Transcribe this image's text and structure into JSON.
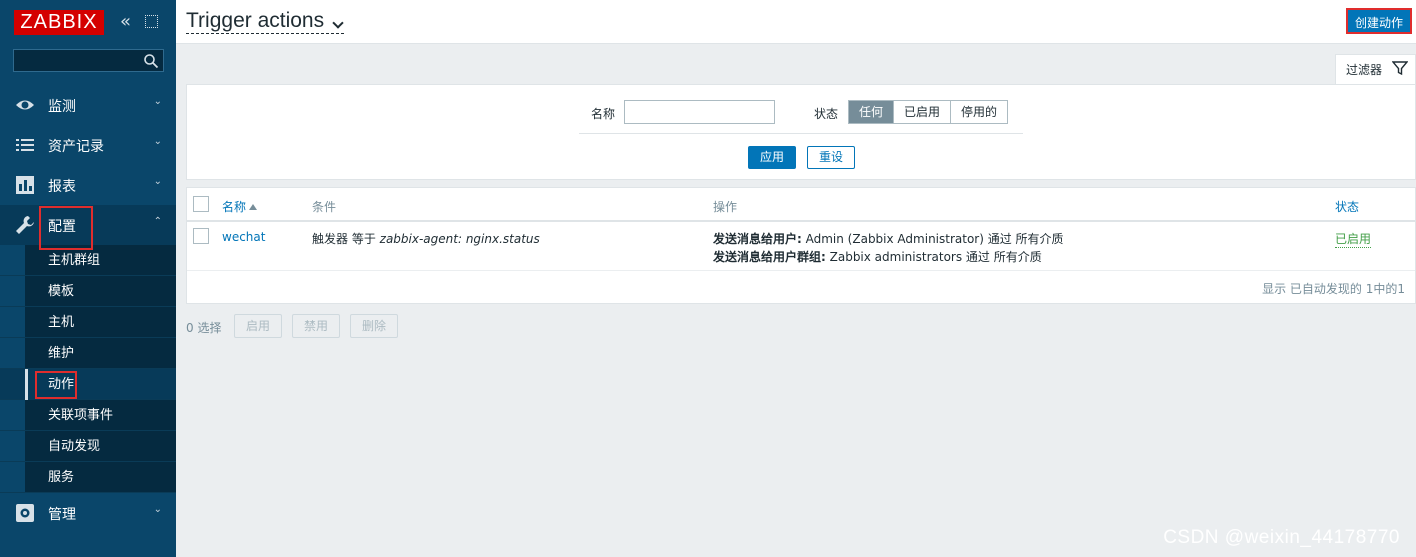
{
  "sidebar": {
    "logo": "ZABBIX",
    "search": {
      "value": "",
      "placeholder": ""
    },
    "menu": [
      {
        "label": "监测",
        "icon": "eye-icon"
      },
      {
        "label": "资产记录",
        "icon": "list-icon"
      },
      {
        "label": "报表",
        "icon": "bar-chart-icon"
      },
      {
        "label": "配置",
        "icon": "wrench-icon"
      },
      {
        "label": "管理",
        "icon": "gear-icon"
      }
    ],
    "submenu": [
      "主机群组",
      "模板",
      "主机",
      "维护",
      "动作",
      "关联项事件",
      "自动发现",
      "服务"
    ]
  },
  "header": {
    "title": "Trigger actions",
    "create_button": "创建动作"
  },
  "filter": {
    "tab_label": "过滤器",
    "name_label": "名称",
    "name_value": "",
    "status_label": "状态",
    "status_options": [
      "任何",
      "已启用",
      "停用的"
    ],
    "status_selected": "任何",
    "apply": "应用",
    "reset": "重设"
  },
  "table": {
    "columns": [
      "名称",
      "条件",
      "操作",
      "状态"
    ],
    "rows": [
      {
        "name": "wechat",
        "condition_prefix": "触发器 等于 ",
        "condition_value": "zabbix-agent: nginx.status",
        "op1_label": "发送消息给用户:",
        "op1_text": " Admin (Zabbix Administrator) 通过 所有介质",
        "op2_label": "发送消息给用户群组:",
        "op2_text": " Zabbix administrators 通过 所有介质",
        "status": "已启用"
      }
    ],
    "footer": "显示 已自动发现的 1中的1"
  },
  "mass_actions": {
    "selected": "0 选择",
    "buttons": [
      "启用",
      "禁用",
      "删除"
    ]
  },
  "colors": {
    "sidebar": "#0a466a",
    "accent": "#0275b8",
    "enabled": "#429e47",
    "highlight": "#e02d2d"
  },
  "watermark": "CSDN @weixin_44178770"
}
